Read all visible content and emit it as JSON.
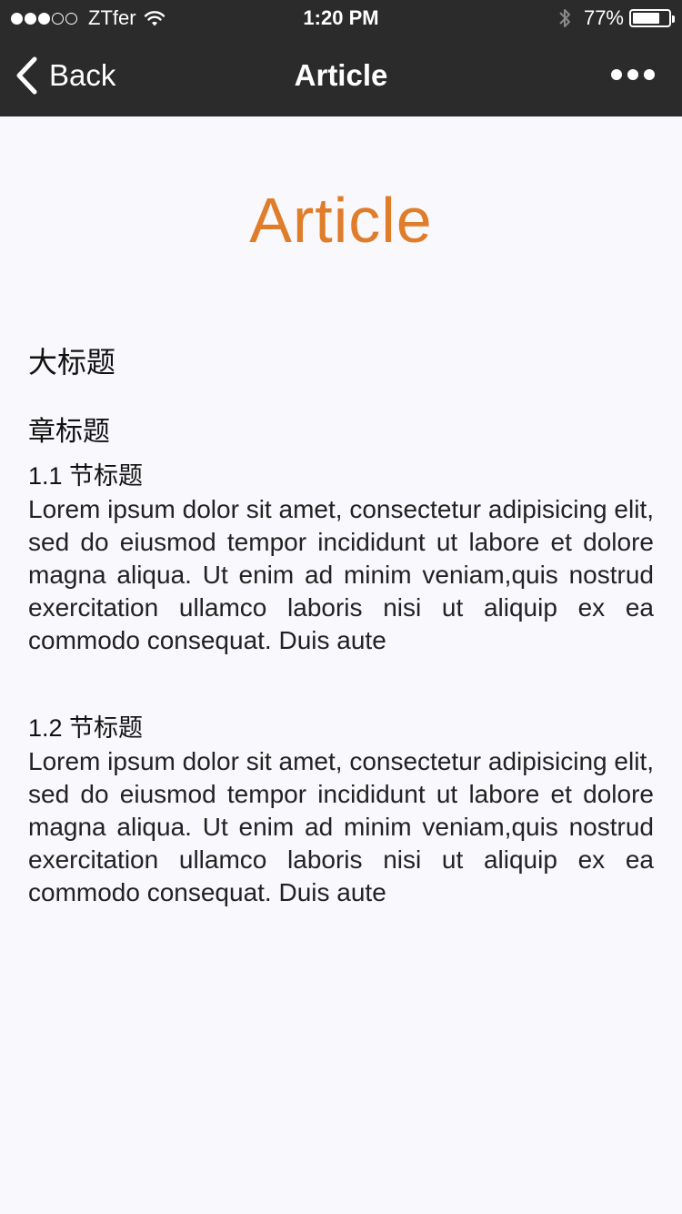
{
  "status_bar": {
    "carrier": "ZTfer",
    "signal_filled": 3,
    "signal_total": 5,
    "time": "1:20 PM",
    "battery_percent": "77%",
    "battery_level": 0.77
  },
  "nav": {
    "back_label": "Back",
    "title": "Article",
    "more_icon": "more-horizontal-icon"
  },
  "article": {
    "title": "Article",
    "title_color": "#e07d2a",
    "main_heading": "大标题",
    "chapter_heading": "章标题",
    "sections": [
      {
        "heading": "1.1 节标题",
        "body": "Lorem ipsum dolor sit amet, consectetur adipisicing elit, sed do eiusmod tempor incididunt ut labore et dolore magna aliqua. Ut enim ad minim veniam,quis nostrud exercitation ullamco laboris nisi ut aliquip ex ea commodo consequat. Duis aute"
      },
      {
        "heading": "1.2 节标题",
        "body": "Lorem ipsum dolor sit amet, consectetur adipisicing elit, sed do eiusmod tempor incididunt ut labore et dolore magna aliqua. Ut enim ad minim veniam,quis nostrud exercitation ullamco laboris nisi ut aliquip ex ea commodo consequat. Duis aute"
      }
    ]
  }
}
